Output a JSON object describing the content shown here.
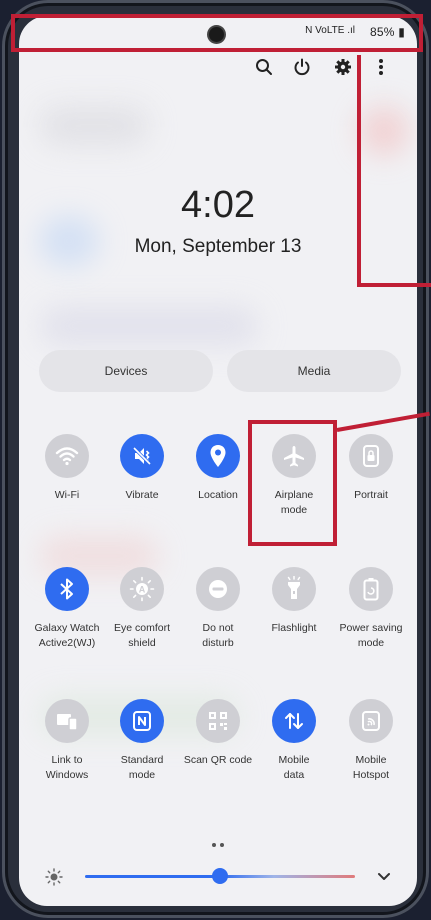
{
  "status_bar": {
    "battery": "85%",
    "icons": "N VoLTE .ıl"
  },
  "header_icons": [
    "search-icon",
    "power-icon",
    "gear-icon",
    "more-icon"
  ],
  "clock": {
    "time": "4:02",
    "date": "Mon, September 13"
  },
  "pills": {
    "devices": "Devices",
    "media": "Media"
  },
  "tiles": [
    {
      "name": "wifi",
      "label": "Wi-Fi",
      "icon": "wifi-icon",
      "on": false
    },
    {
      "name": "vibrate",
      "label": "Vibrate",
      "icon": "vibrate-icon",
      "on": true
    },
    {
      "name": "location",
      "label": "Location",
      "icon": "location-icon",
      "on": true
    },
    {
      "name": "airplane",
      "label": "Airplane\nmode",
      "icon": "airplane-icon",
      "on": false
    },
    {
      "name": "portrait",
      "label": "Portrait",
      "icon": "portrait-lock-icon",
      "on": false
    },
    {
      "name": "galaxy-watch",
      "label": "Galaxy Watch\nActive2(WJ)",
      "icon": "bluetooth-icon",
      "on": true
    },
    {
      "name": "eye-comfort",
      "label": "Eye comfort\nshield",
      "icon": "eye-comfort-icon",
      "on": false
    },
    {
      "name": "do-not-disturb",
      "label": "Do not\ndisturb",
      "icon": "do-not-disturb-icon",
      "on": false
    },
    {
      "name": "flashlight",
      "label": "Flashlight",
      "icon": "flashlight-icon",
      "on": false
    },
    {
      "name": "power-saving",
      "label": "Power saving\nmode",
      "icon": "power-saving-icon",
      "on": false
    },
    {
      "name": "link-to-windows",
      "label": "Link to\nWindows",
      "icon": "link-windows-icon",
      "on": false
    },
    {
      "name": "standard-mode",
      "label": "Standard\nmode",
      "icon": "nfc-icon",
      "on": true
    },
    {
      "name": "scan-qr",
      "label": "Scan QR code",
      "icon": "qr-code-icon",
      "on": false
    },
    {
      "name": "mobile-data",
      "label": "Mobile\ndata",
      "icon": "mobile-data-icon",
      "on": true
    },
    {
      "name": "mobile-hotspot",
      "label": "Mobile\nHotspot",
      "icon": "hotspot-icon",
      "on": false
    }
  ],
  "colors": {
    "accent": "#2f6cf0",
    "highlight": "#c01f35",
    "tile_off": "#cfcfd4"
  },
  "brightness": {
    "level_fraction": 0.5
  }
}
